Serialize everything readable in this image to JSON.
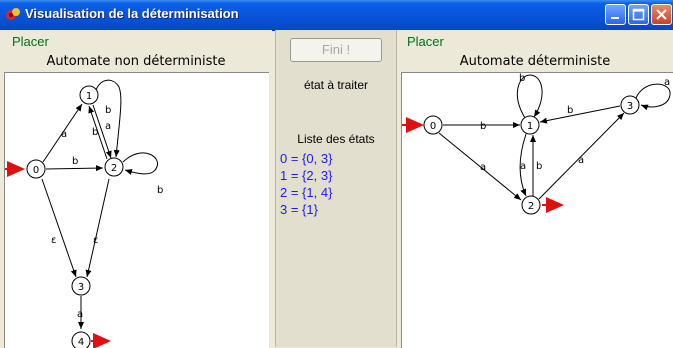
{
  "window": {
    "title": "Visualisation de la déterminisation"
  },
  "left": {
    "place_link": "Placer",
    "title": "Automate non déterministe"
  },
  "middle": {
    "button": "Fini !",
    "status": "état à traiter",
    "list_title": "Liste des états",
    "states": [
      "0 = {0, 3}",
      "1 = {2, 3}",
      "2 = {1, 4}",
      "3 = {1}"
    ]
  },
  "right": {
    "place_link": "Placer",
    "title": "Automate déterministe"
  },
  "nfa": {
    "nodes": [
      "0",
      "1",
      "2",
      "3",
      "4"
    ],
    "edge_labels": [
      "a",
      "b",
      "a",
      "b",
      "b",
      "b",
      "ε",
      "ε",
      "a"
    ]
  },
  "dfa": {
    "nodes": [
      "0",
      "1",
      "2",
      "3"
    ],
    "edge_labels": [
      "b",
      "b",
      "b",
      "a",
      "a",
      "b",
      "a",
      "a"
    ]
  },
  "colors": {
    "link": "#00701a",
    "state_list": "#1a1aff",
    "arrow": "#e01010",
    "titlebar": "#0854d9"
  }
}
